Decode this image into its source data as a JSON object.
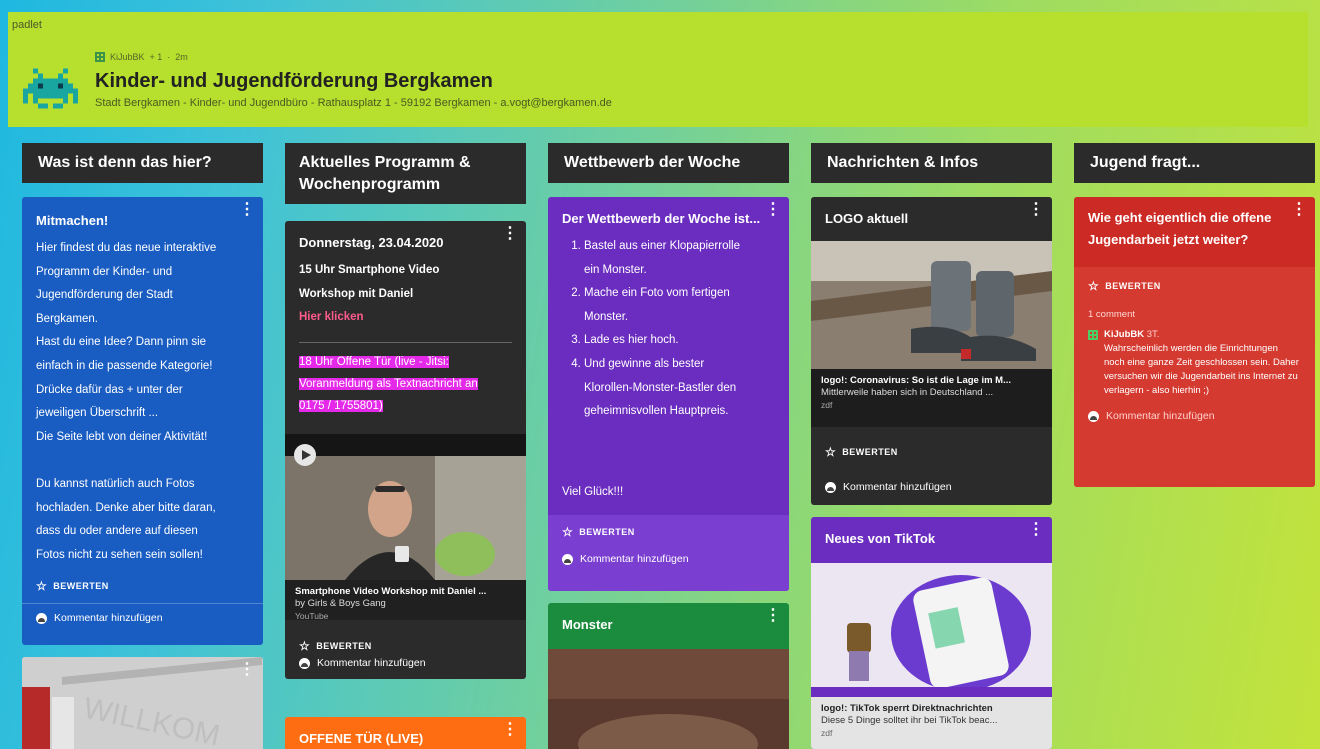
{
  "app": {
    "logo": "padlet"
  },
  "header": {
    "meta_user": "KiJubBK",
    "meta_likes": "+ 1",
    "meta_sep": "·",
    "meta_time": "2m",
    "title": "Kinder- und Jugendförderung Bergkamen",
    "subtitle": "Stadt Bergkamen - Kinder- und Jugendbüro - Rathausplatz 1 - 59192 Bergkamen - a.vogt@bergkamen.de"
  },
  "labels": {
    "rate": "BEWERTEN",
    "comment_add": "Kommentar hinzufügen"
  },
  "columns": [
    {
      "title": "Was ist denn das hier?"
    },
    {
      "title": "Aktuelles Programm & Wochenprogramm"
    },
    {
      "title": "Wettbewerb der Woche"
    },
    {
      "title": "Nachrichten & Infos"
    },
    {
      "title": "Jugend fragt..."
    }
  ],
  "col1": {
    "card1_title": "Mitmachen!",
    "card1_body": [
      "Hier findest du das neue interaktive",
      "Programm der Kinder- und",
      "Jugendförderung der Stadt",
      "Bergkamen.",
      "Hast du eine Idee? Dann pinn sie",
      "einfach in die passende Kategorie!",
      "Drücke dafür das + unter der",
      "jeweiligen Überschrift ...",
      "Die Seite lebt von deiner Aktivität!",
      "",
      "Du kannst natürlich auch Fotos",
      "hochladen. Denke aber bitte daran,",
      "dass du oder andere auf diesen",
      "Fotos nicht zu sehen sein sollen!"
    ]
  },
  "col2": {
    "card1_title": "Donnerstag, 23.04.2020",
    "line1": "15 Uhr Smartphone Video",
    "line2": "Workshop mit Daniel",
    "link": "Hier klicken",
    "hl1": "18 Uhr Offene Tür (live - Jitsi:",
    "hl2": "Voranmeldung als Textnachricht an",
    "hl3": "0175 / 1755801)",
    "video_title": "Smartphone Video Workshop mit Daniel ...",
    "video_by": "by Girls & Boys Gang",
    "video_src": "YouTube",
    "card2_title": "OFFENE TÜR (LIVE)"
  },
  "col3": {
    "card1_title": "Der Wettbewerb der Woche ist...",
    "steps": [
      "Bastel aus einer Klopapierrolle ein Monster.",
      "Mache ein Foto vom fertigen Monster.",
      "Lade es hier hoch.",
      "Und gewinne als bester Klorollen-Monster-Bastler den geheimnisvollen Hauptpreis."
    ],
    "steps_lines": [
      [
        "Bastel aus einer Klopapierrolle",
        "ein Monster."
      ],
      [
        "Mache ein Foto vom fertigen",
        "Monster."
      ],
      [
        "Lade es hier hoch."
      ],
      [
        "Und gewinne als bester",
        "Klorollen-Monster-Bastler den",
        "geheimnisvollen Hauptpreis."
      ]
    ],
    "closing": "Viel Glück!!!",
    "card2_title": "Monster"
  },
  "col4": {
    "card1_title": "LOGO aktuell",
    "card1_cap_title": "logo!: Coronavirus: So ist die Lage im M...",
    "card1_cap_text": "Mittlerweile haben sich in Deutschland ...",
    "card1_cap_src": "zdf",
    "card2_title": "Neues von TikTok",
    "card2_cap_title": "logo!: TikTok sperrt Direktnachrichten",
    "card2_cap_text": "Diese 5 Dinge solltet ihr bei TikTok beac...",
    "card2_cap_src": "zdf"
  },
  "col5": {
    "card1_title": "Wie geht eigentlich die offene Jugendarbeit jetzt weiter?",
    "comment_count": "1 comment",
    "comment_user": "KiJubBK",
    "comment_time": "3T.",
    "comment_text": "Wahrscheinlich werden die Einrichtungen noch eine ganze Zeit geschlossen sein. Daher versuchen wir die Jugendarbeit ins Internet zu verlagern - also hierhin ;)"
  }
}
